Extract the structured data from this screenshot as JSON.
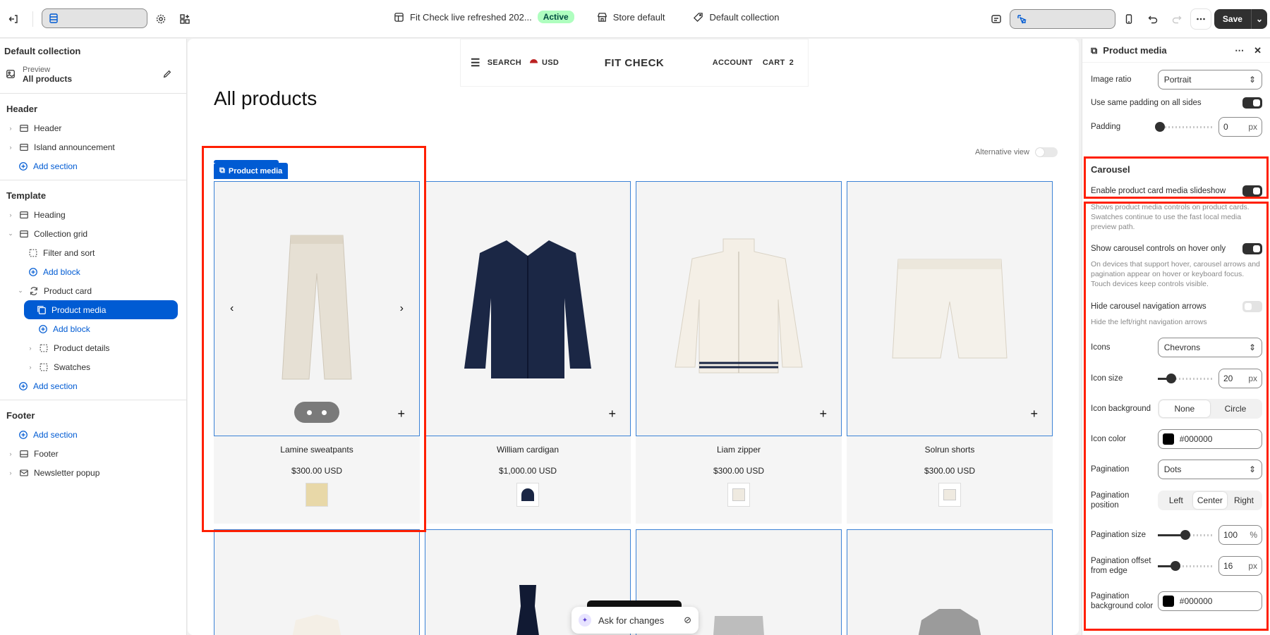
{
  "topbar": {
    "theme_name": "Fit Check live refreshed 202...",
    "status": "Active",
    "store": "Store default",
    "collection": "Default collection",
    "save_label": "Save"
  },
  "left": {
    "title": "Default collection",
    "preview_label": "Preview",
    "preview_value": "All products",
    "groups": {
      "header": "Header",
      "template": "Template",
      "footer": "Footer"
    },
    "items": {
      "header": "Header",
      "island": "Island announcement",
      "add_section_1": "Add section",
      "heading": "Heading",
      "collection_grid": "Collection grid",
      "filter_sort": "Filter and sort",
      "add_block_1": "Add block",
      "product_card": "Product card",
      "product_media": "Product media",
      "add_block_2": "Add block",
      "product_details": "Product details",
      "swatches": "Swatches",
      "add_section_2": "Add section",
      "add_section_3": "Add section",
      "footer": "Footer",
      "newsletter": "Newsletter popup"
    }
  },
  "store": {
    "nav_search": "SEARCH",
    "currency": "USD",
    "logo": "FIT CHECK",
    "account": "ACCOUNT",
    "cart": "CART",
    "cart_count": "2",
    "page_title": "All products",
    "alt_view": "Alternative view",
    "media_label": "Product media",
    "ask": "Ask for changes",
    "products": [
      {
        "name": "Lamine sweatpants",
        "price": "$300.00 USD",
        "swatch": "#e8d8a8"
      },
      {
        "name": "William cardigan",
        "price": "$1,000.00 USD",
        "swatch": "#1b2745"
      },
      {
        "name": "Liam zipper",
        "price": "$300.00 USD",
        "swatch": "#efeae0"
      },
      {
        "name": "Solrun shorts",
        "price": "$300.00 USD",
        "swatch": "#efeae0"
      }
    ]
  },
  "panel": {
    "title": "Product media",
    "image_ratio_label": "Image ratio",
    "image_ratio": "Portrait",
    "same_padding_label": "Use same padding on all sides",
    "padding_label": "Padding",
    "padding_value": "0",
    "px": "px",
    "carousel_title": "Carousel",
    "enable_slideshow_label": "Enable product card media slideshow",
    "enable_slideshow_help": "Shows product media controls on product cards. Swatches continue to use the fast local media preview path.",
    "hover_only_label": "Show carousel controls on hover only",
    "hover_only_help": "On devices that support hover, carousel arrows and pagination appear on hover or keyboard focus. Touch devices keep controls visible.",
    "hide_arrows_label": "Hide carousel navigation arrows",
    "hide_arrows_help": "Hide the left/right navigation arrows",
    "icons_label": "Icons",
    "icons_value": "Chevrons",
    "icon_size_label": "Icon size",
    "icon_size_value": "20",
    "icon_bg_label": "Icon background",
    "icon_bg_options": [
      "None",
      "Circle"
    ],
    "icon_color_label": "Icon color",
    "icon_color_value": "#000000",
    "pagination_label": "Pagination",
    "pagination_value": "Dots",
    "pagination_pos_label": "Pagination position",
    "pagination_pos_options": [
      "Left",
      "Center",
      "Right"
    ],
    "pagination_size_label": "Pagination size",
    "pagination_size_value": "100",
    "percent": "%",
    "offset_label": "Pagination offset from edge",
    "offset_value": "16",
    "pg_bg_label": "Pagination background color",
    "pg_bg_value": "#000000"
  }
}
